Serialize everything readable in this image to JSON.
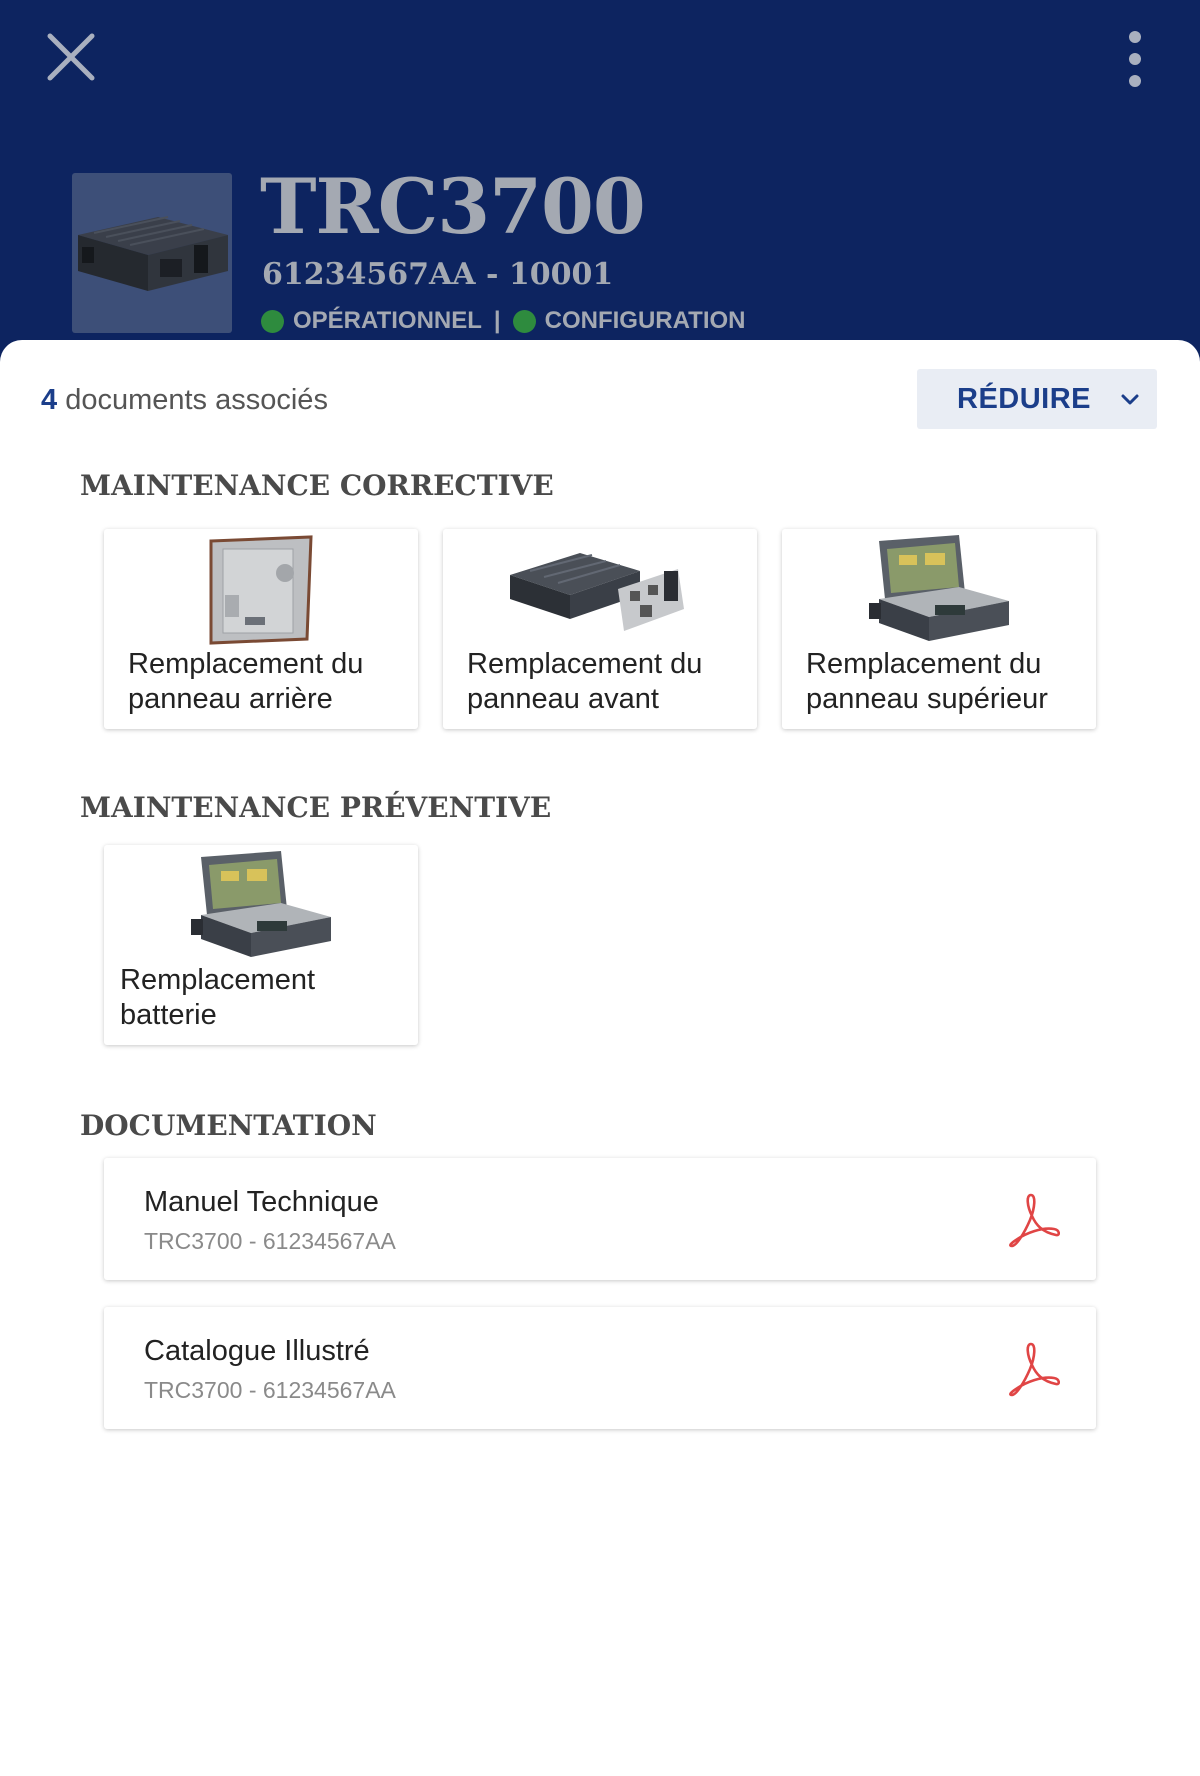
{
  "header": {
    "title": "TRC3700",
    "subtitle": "61234567AA - 10001",
    "status": [
      {
        "label": "OPÉRATIONNEL",
        "color": "#2e8b3e"
      },
      {
        "label": "CONFIGURATION",
        "color": "#2e8b3e"
      }
    ],
    "separator": "|",
    "background_color": "#0d2460"
  },
  "summary": {
    "count": "4",
    "label": " documents associés",
    "reduce_label": "RÉDUIRE"
  },
  "sections": {
    "corrective": {
      "title": "MAINTENANCE CORRECTIVE",
      "cards": [
        {
          "label": "Remplacement du panneau arrière"
        },
        {
          "label": "Remplacement du panneau avant"
        },
        {
          "label": "Remplacement du panneau supérieur"
        }
      ]
    },
    "preventive": {
      "title": "MAINTENANCE PRÉVENTIVE",
      "cards": [
        {
          "label": "Remplacement batterie"
        }
      ]
    },
    "documentation": {
      "title": "DOCUMENTATION",
      "items": [
        {
          "title": "Manuel Technique",
          "subtitle": "TRC3700 - 61234567AA",
          "icon": "pdf-icon"
        },
        {
          "title": "Catalogue Illustré",
          "subtitle": "TRC3700 - 61234567AA",
          "icon": "pdf-icon"
        }
      ]
    }
  },
  "colors": {
    "accent": "#1b3e8a",
    "status_ok": "#2e8b3e",
    "pdf_red": "#e04545"
  }
}
